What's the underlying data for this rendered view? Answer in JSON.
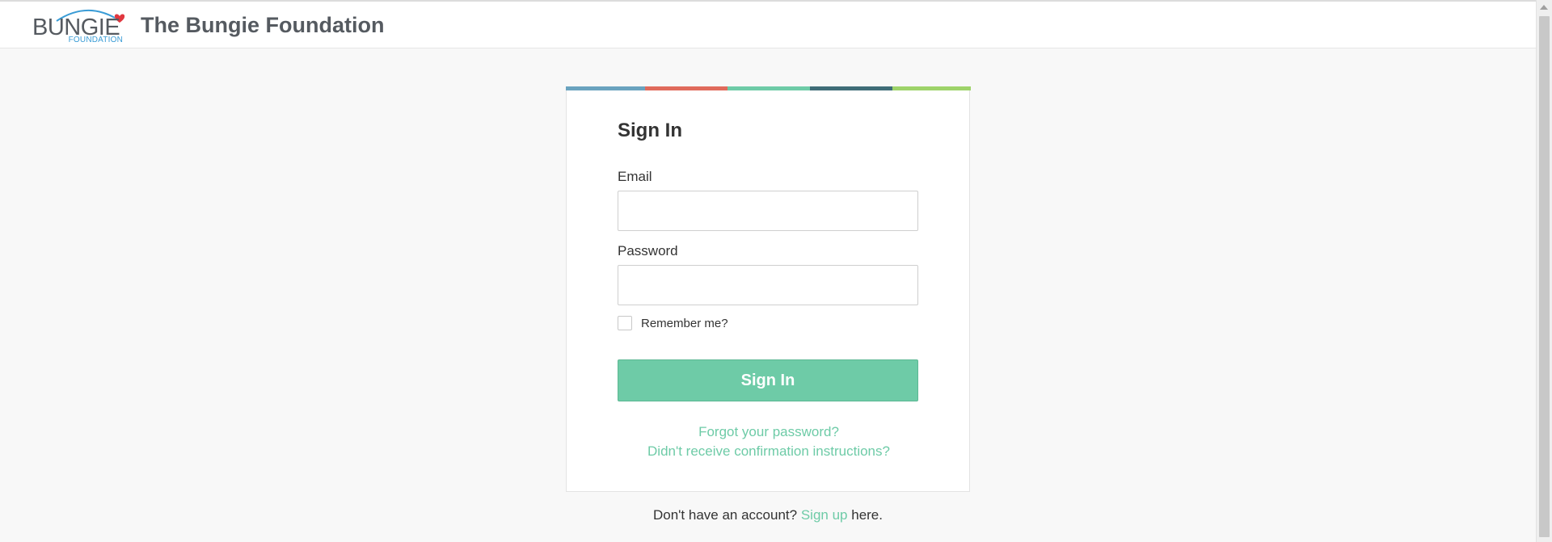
{
  "header": {
    "logo_word": "BUNGIE",
    "logo_sub": "FOUNDATION",
    "site_title": "The Bungie Foundation"
  },
  "signin": {
    "title": "Sign In",
    "email_label": "Email",
    "email_value": "",
    "password_label": "Password",
    "password_value": "",
    "remember_label": "Remember me?",
    "remember_checked": false,
    "submit_label": "Sign In",
    "forgot_link": "Forgot your password?",
    "confirm_link": "Didn't receive confirmation instructions?"
  },
  "footer": {
    "prefix": "Don't have an account?",
    "signup_link": "Sign up",
    "suffix": "here."
  },
  "colors": {
    "accent": "#6ecba7",
    "stripe": [
      "#6aa3bf",
      "#e06b5c",
      "#6ecba7",
      "#3f6d78",
      "#9ed36a"
    ],
    "logo_blue": "#3a9cd6",
    "logo_heart": "#e0373f"
  }
}
